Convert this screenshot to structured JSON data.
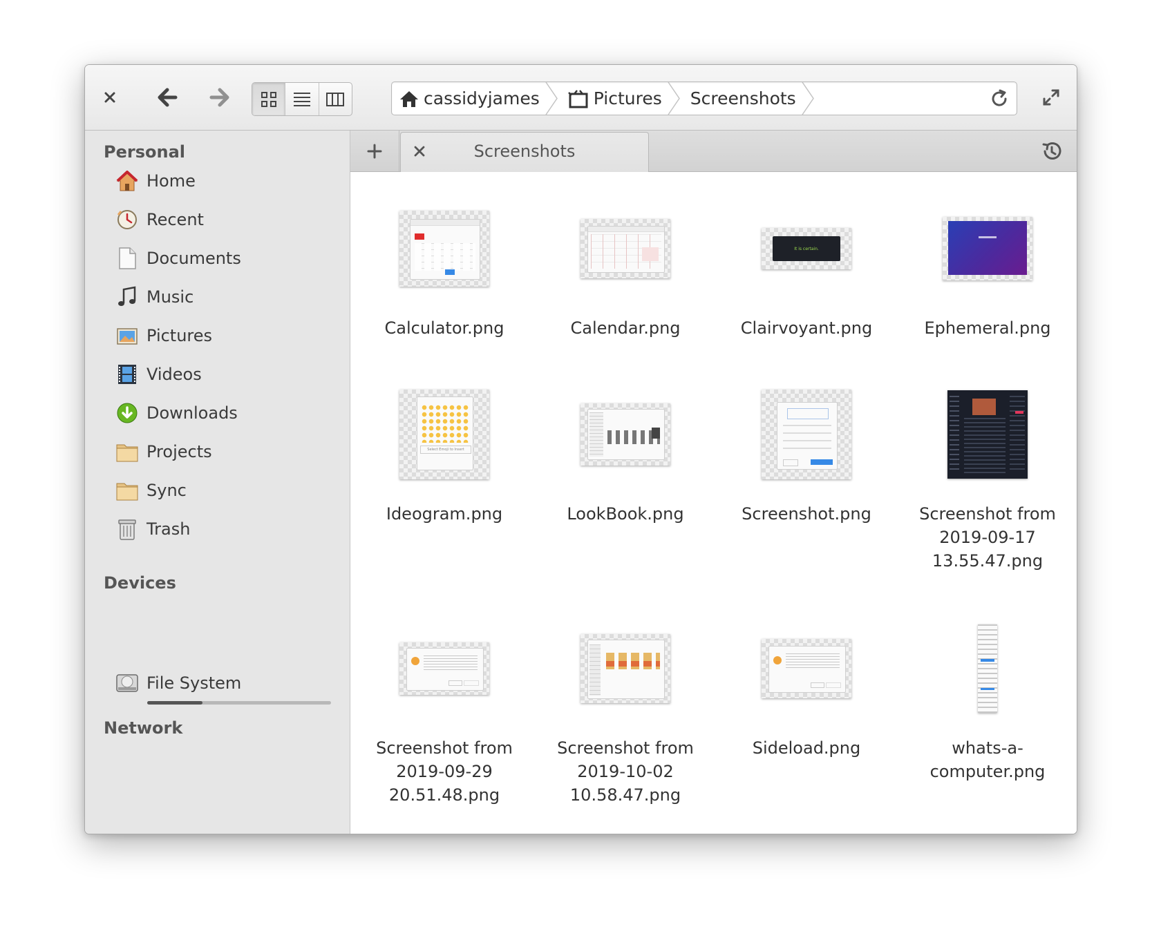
{
  "toolbar": {
    "view_modes": [
      "icon-view",
      "list-view",
      "column-view"
    ],
    "active_view": "icon-view"
  },
  "pathbar": {
    "crumbs": [
      {
        "label": "cassidyjames",
        "icon": "home-icon"
      },
      {
        "label": "Pictures",
        "icon": "pictures-folder-icon"
      },
      {
        "label": "Screenshots",
        "icon": ""
      }
    ]
  },
  "sidebar": {
    "personal_heading": "Personal",
    "personal": [
      {
        "label": "Home",
        "icon": "home-icon"
      },
      {
        "label": "Recent",
        "icon": "recent-clock-icon"
      },
      {
        "label": "Documents",
        "icon": "document-icon"
      },
      {
        "label": "Music",
        "icon": "music-note-icon"
      },
      {
        "label": "Pictures",
        "icon": "pictures-icon"
      },
      {
        "label": "Videos",
        "icon": "film-icon"
      },
      {
        "label": "Downloads",
        "icon": "download-icon"
      },
      {
        "label": "Projects",
        "icon": "folder-icon"
      },
      {
        "label": "Sync",
        "icon": "folder-icon"
      },
      {
        "label": "Trash",
        "icon": "trash-icon"
      }
    ],
    "devices_heading": "Devices",
    "devices": [
      {
        "label": "File System",
        "icon": "harddisk-icon",
        "usage_fraction": 0.3
      }
    ],
    "network_heading": "Network"
  },
  "tabs": {
    "items": [
      {
        "label": "Screenshots"
      }
    ]
  },
  "files": [
    {
      "name": "Calculator.png",
      "thumb": "calculator"
    },
    {
      "name": "Calendar.png",
      "thumb": "calendar"
    },
    {
      "name": "Clairvoyant.png",
      "thumb": "clairvoyant",
      "thumb_text": "It is certain."
    },
    {
      "name": "Ephemeral.png",
      "thumb": "ephemeral"
    },
    {
      "name": "Ideogram.png",
      "thumb": "ideogram",
      "thumb_text": "Select Emoji to Insert"
    },
    {
      "name": "LookBook.png",
      "thumb": "lookbook"
    },
    {
      "name": "Screenshot.png",
      "thumb": "screenshot"
    },
    {
      "name": "Screenshot from 2019-09-17 13.55.47.png",
      "thumb": "dark-app"
    },
    {
      "name": "Screenshot from 2019-09-29 20.51.48.png",
      "thumb": "dialog"
    },
    {
      "name": "Screenshot from 2019-10-02 10.58.47.png",
      "thumb": "files"
    },
    {
      "name": "Sideload.png",
      "thumb": "dialog2"
    },
    {
      "name": "whats-a-computer.png",
      "thumb": "mobile"
    }
  ],
  "colors": {
    "accent_blue": "#3689e6",
    "downloads_green": "#68b723",
    "home_red": "#c6262e"
  }
}
